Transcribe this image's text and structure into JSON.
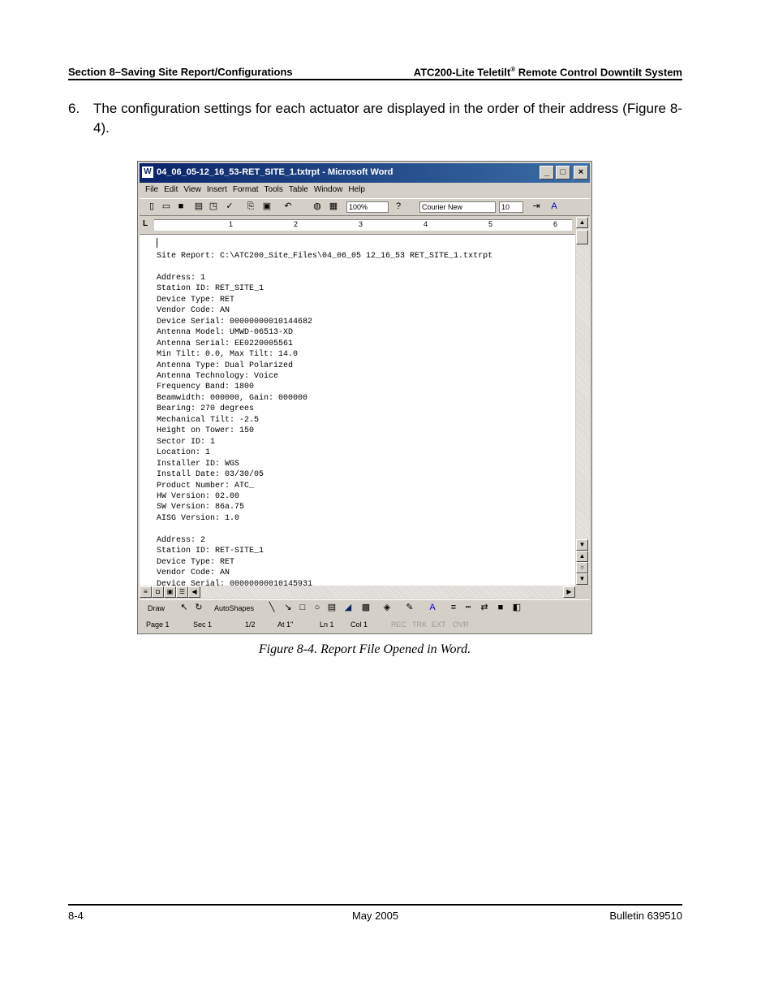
{
  "header": {
    "left": "Section 8–Saving Site Report/Configurations",
    "right_main": "ATC200-Lite Teletilt",
    "right_reg": "®",
    "right_tail": " Remote Control Downtilt System"
  },
  "step": {
    "number": "6.",
    "text": "The configuration settings for each actuator are displayed in the order of their address (Figure 8-4)."
  },
  "word": {
    "title": "04_06_05-12_16_53-RET_SITE_1.txtrpt - Microsoft Word",
    "title_buttons": {
      "minimize": "_",
      "maximize": "□",
      "close": "×"
    },
    "menus": [
      "File",
      "Edit",
      "View",
      "Insert",
      "Format",
      "Tools",
      "Table",
      "Window",
      "Help"
    ],
    "zoom": "100%",
    "font_name": "Courier New",
    "font_size": "10",
    "ruler_numbers": [
      "1",
      "2",
      "3",
      "4",
      "5",
      "6"
    ],
    "document_text": "Site Report: C:\\ATC200_Site_Files\\04_06_05 12_16_53 RET_SITE_1.txtrpt\n\nAddress: 1\nStation ID: RET_SITE_1\nDevice Type: RET\nVendor Code: AN\nDevice Serial: 00000000010144682\nAntenna Model: UMWD-06513-XD\nAntenna Serial: EE0220005561\nMin Tilt: 0.0, Max Tilt: 14.0\nAntenna Type: Dual Polarized\nAntenna Technology: Voice\nFrequency Band: 1800\nBeamwidth: 000000, Gain: 000000\nBearing: 270 degrees\nMechanical Tilt: -2.5\nHeight on Tower: 150\nSector ID: 1\nLocation: 1\nInstaller ID: WGS\nInstall Date: 03/30/05\nProduct Number: ATC_\nHW Version: 02.00\nSW Version: 86a.75\nAISG Version: 1.0\n\nAddress: 2\nStation ID: RET-SITE_1\nDevice Type: RET\nVendor Code: AN\nDevice Serial: 00000000010145931",
    "draw_label": "Draw",
    "autoshapes_label": "AutoShapes",
    "status": {
      "page": "Page 1",
      "sec": "Sec 1",
      "pages": "1/2",
      "at": "At 1\"",
      "ln": "Ln 1",
      "col": "Col 1",
      "rec": "REC",
      "trk": "TRK",
      "ext": "EXT",
      "ovr": "OVR"
    }
  },
  "caption": "Figure 8-4. Report File Opened in Word.",
  "footer": {
    "left": "8-4",
    "center": "May 2005",
    "right": "Bulletin 639510"
  }
}
